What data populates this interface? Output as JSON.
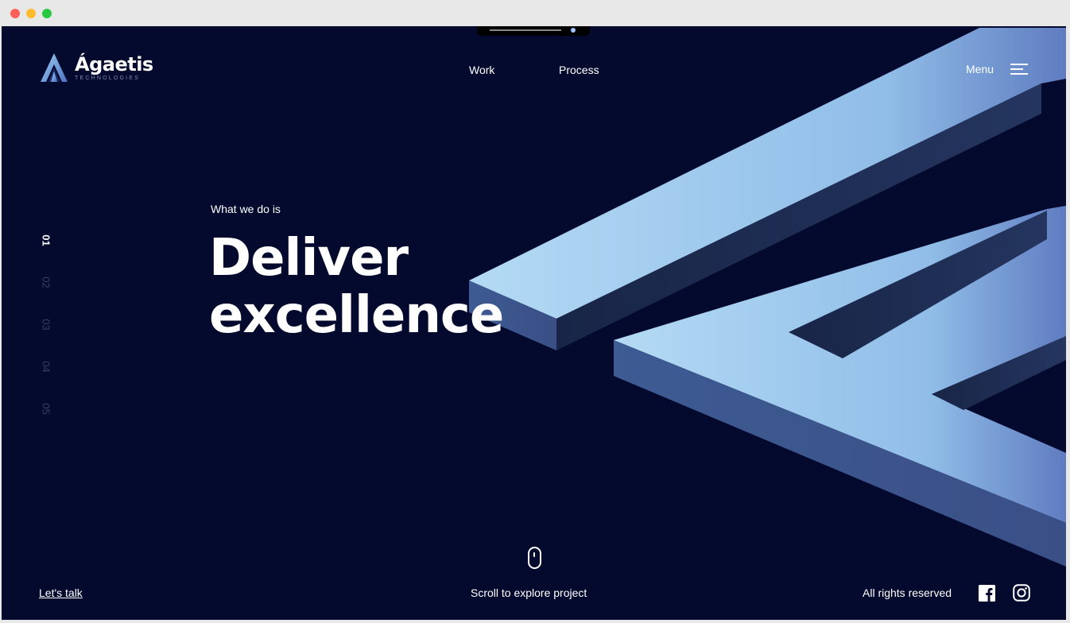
{
  "brand": {
    "name": "Ágaetis",
    "tagline": "TECHNOLOGIES"
  },
  "nav": {
    "work": "Work",
    "process": "Process",
    "menu": "Menu"
  },
  "pager": [
    "01",
    "02",
    "03",
    "04",
    "05"
  ],
  "hero": {
    "eyebrow": "What we do is",
    "line1": "Deliver",
    "line2": "excellence"
  },
  "footer": {
    "lets_talk": "Let's talk",
    "scroll": "Scroll to explore project",
    "rights": "All rights reserved"
  },
  "icons": {
    "logo": "agaetis-logo-icon",
    "menu": "hamburger-icon",
    "mouse": "mouse-icon",
    "facebook": "facebook-icon",
    "instagram": "instagram-icon"
  },
  "colors": {
    "background": "#040a2d",
    "accent_light": "#a6cdf0",
    "accent_dark": "#5b78bf",
    "text": "#ffffff",
    "pager_inactive": "#3a3f5f"
  }
}
